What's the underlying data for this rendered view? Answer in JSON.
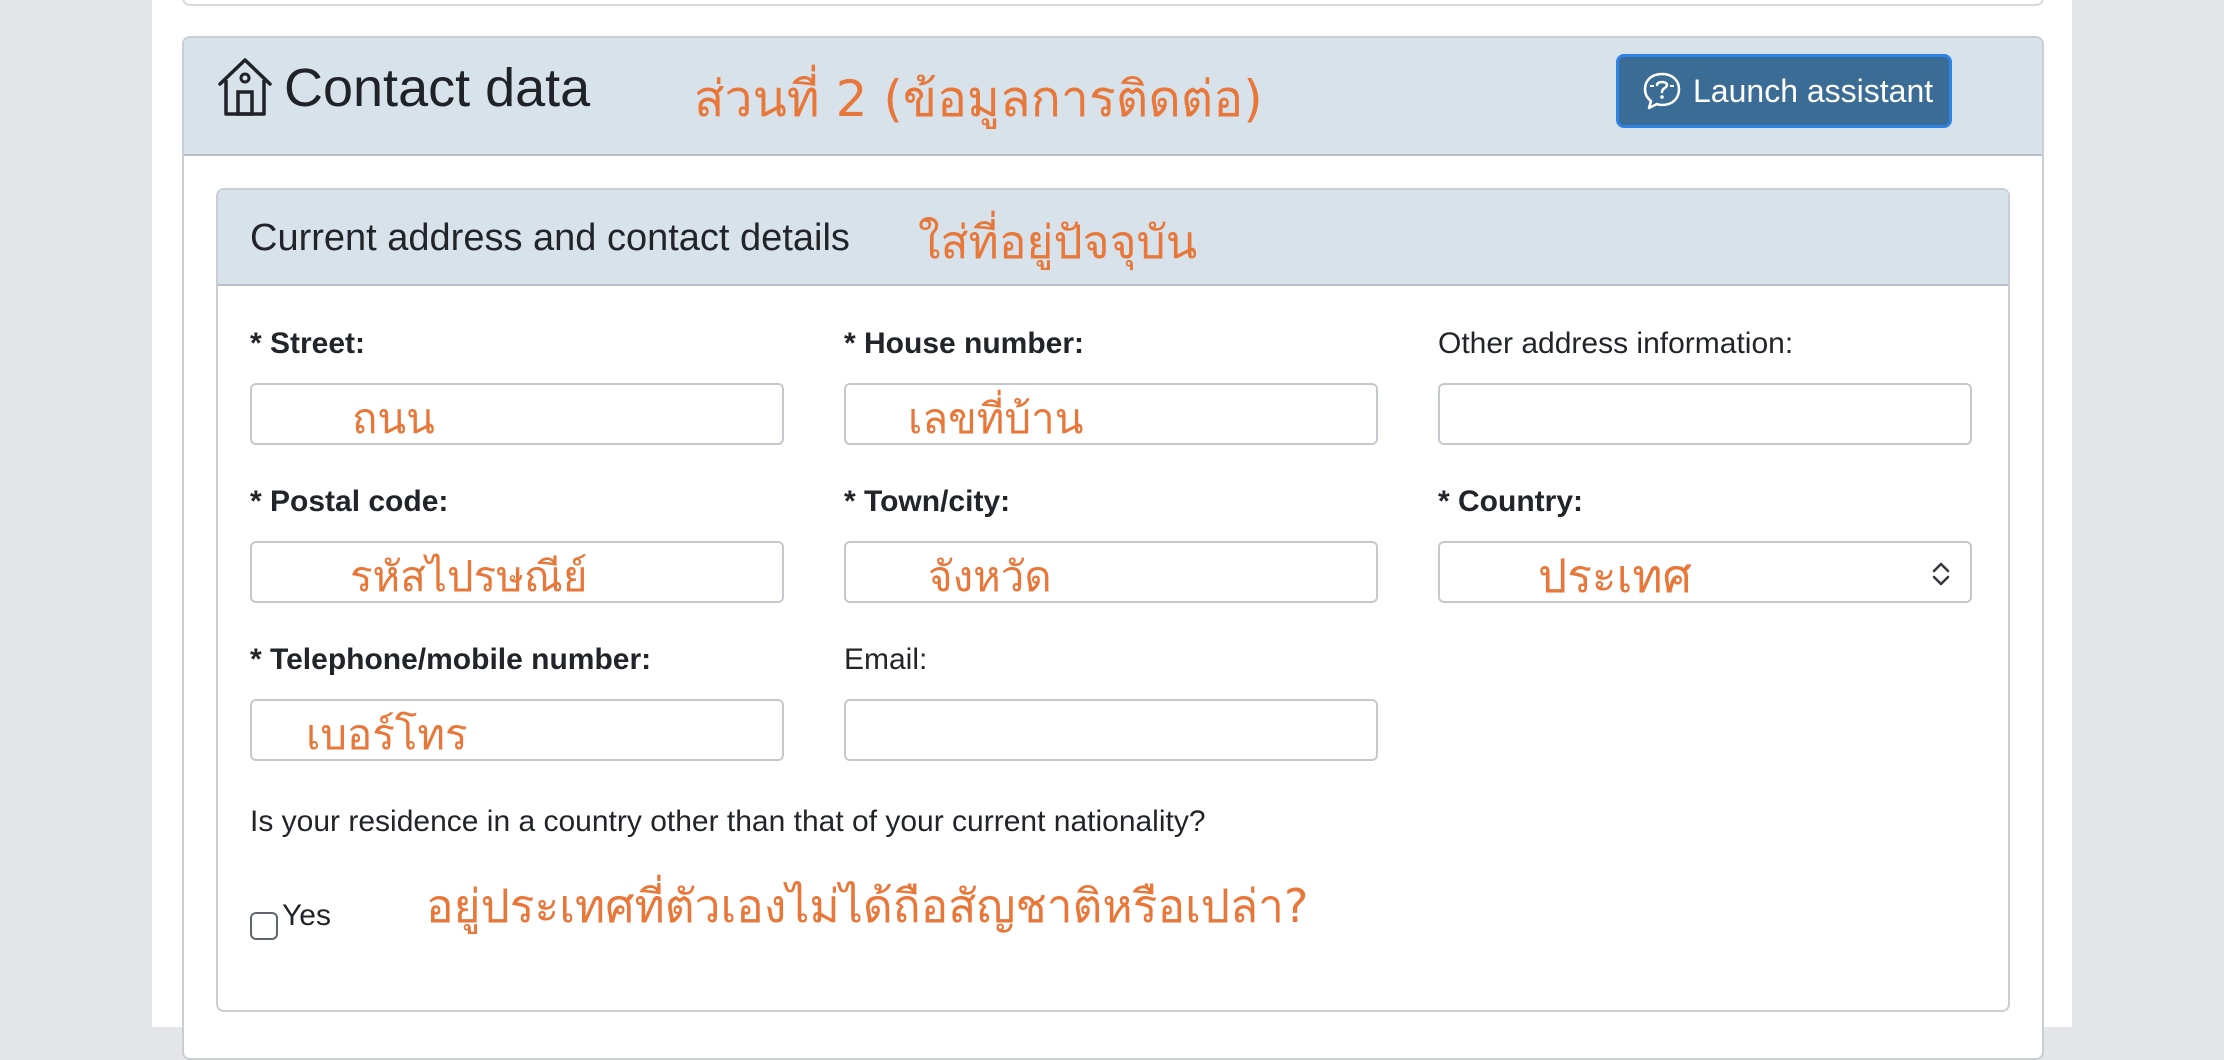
{
  "section": {
    "title": "Contact data",
    "assistant_button": "Launch assistant",
    "handwritten_note": "ส่วนที่ 2 (ข้อมูลการติดต่อ)"
  },
  "address_panel": {
    "title": "Current address and contact details",
    "handwritten_note": "ใส่ที่อยู่ปัจจุบัน"
  },
  "fields": {
    "street": {
      "label": "* Street:",
      "note": "ถนน"
    },
    "house_number": {
      "label": "* House number:",
      "note": "เลขที่บ้าน"
    },
    "other_info": {
      "label": "Other address information:"
    },
    "postal_code": {
      "label": "* Postal code:",
      "note": "รหัสไปรษณีย์"
    },
    "town_city": {
      "label": "* Town/city:",
      "note": "จังหวัด"
    },
    "country": {
      "label": "* Country:",
      "note": "ประเทศ"
    },
    "telephone": {
      "label": "* Telephone/mobile number:",
      "note": "เบอร์โทร"
    },
    "email": {
      "label": "Email:"
    }
  },
  "residence": {
    "question": "Is your residence in a country other than that of your current nationality?",
    "yes_label": "Yes",
    "checked": false,
    "handwritten_note": "อยู่ประเทศที่ตัวเองไม่ได้ถือสัญชาติหรือเปล่า?"
  },
  "colors": {
    "header_bg": "#d8e2ea",
    "button_bg": "#3a6c96",
    "annotation": "#e8773a"
  },
  "icons": [
    "home-icon",
    "speech-bubble-icon",
    "select-arrows-icon"
  ]
}
